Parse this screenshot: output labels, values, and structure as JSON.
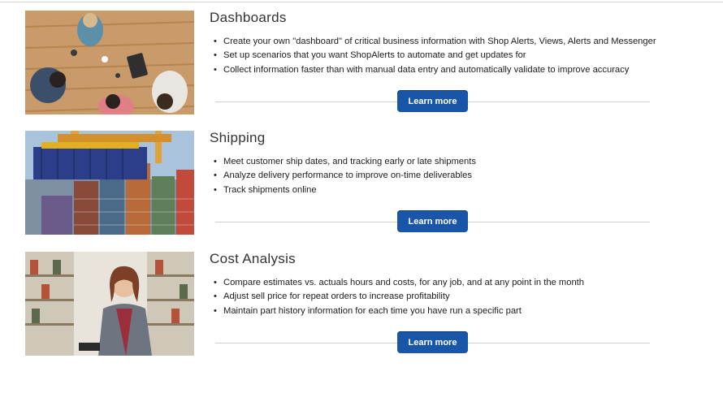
{
  "sections": [
    {
      "title": "Dashboards",
      "image_alt": "people-meeting-photo",
      "bullets": [
        "Create your own \"dashboard\" of critical business information with Shop Alerts, Views, Alerts and Messenger",
        "Set up scenarios that you want ShopAlerts to automate and get updates for",
        "Collect information faster than with manual data entry and automatically validate to improve accuracy"
      ],
      "button_label": "Learn more"
    },
    {
      "title": "Shipping",
      "image_alt": "shipping-containers-photo",
      "bullets": [
        "Meet customer ship dates, and tracking early or late shipments",
        "Analyze delivery performance to improve on-time deliverables",
        "Track shipments online"
      ],
      "button_label": "Learn more"
    },
    {
      "title": "Cost Analysis",
      "image_alt": "warehouse-worker-photo",
      "bullets": [
        "Compare estimates vs. actuals hours and costs, for any job, and at any point in the month",
        "Adjust sell price for repeat orders to increase profitability",
        "Maintain part history information for each time you have run a specific part"
      ],
      "button_label": "Learn more"
    }
  ],
  "colors": {
    "button_bg": "#1a56a8",
    "button_text": "#ffffff",
    "divider": "#cfcfcf"
  }
}
